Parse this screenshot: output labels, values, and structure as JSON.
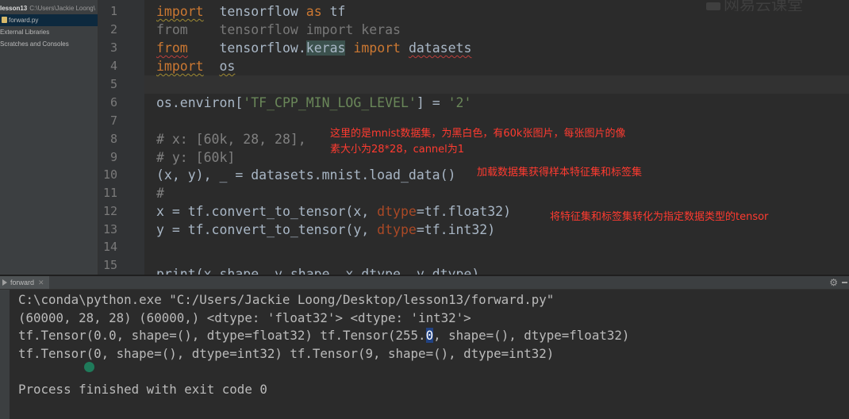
{
  "sidebar": {
    "project_name": "lesson13",
    "project_path": "C:\\Users\\Jackie Loong\\",
    "items": [
      {
        "label": "forward.py"
      },
      {
        "label": "External Libraries"
      },
      {
        "label": "Scratches and Consoles"
      }
    ]
  },
  "editor": {
    "line_numbers": [
      "1",
      "2",
      "3",
      "4",
      "5",
      "6",
      "7",
      "8",
      "9",
      "10",
      "11",
      "12",
      "13",
      "14",
      "15"
    ],
    "code": {
      "l1_kw": "import",
      "l1_mod": "tensorflow",
      "l1_as": "as",
      "l1_alias": "tf",
      "l2": "from    tensorflow import keras",
      "l3_from": "from",
      "l3_mod": "tensorflow.",
      "l3_keras": "keras",
      "l3_import": "import",
      "l3_name": "datasets",
      "l4_kw": "import",
      "l4_mod": "os",
      "l6_pre": "os.environ[",
      "l6_key": "'TF_CPP_MIN_LOG_LEVEL'",
      "l6_mid": "] = ",
      "l6_val": "'2'",
      "l8": "# x: [60k, 28, 28],",
      "l9": "# y: [60k]",
      "l10": "(x, y), _ = datasets.mnist.load_data()",
      "l11": "#",
      "l12_pre": "x = tf.convert_to_tensor(x, ",
      "l12_param": "dtype",
      "l12_post": "=tf.float32)",
      "l13_pre": "y = tf.convert_to_tensor(y, ",
      "l13_param": "dtype",
      "l13_post": "=tf.int32)",
      "l15": "print(x.shape, y.shape, x.dtype, y.dtype)"
    },
    "annotations": {
      "mnist_note_1": "这里的是mnist数据集，为黑白色，有60k张图片，每张图片的像",
      "mnist_note_2": "素大小为28*28，cannel为1",
      "load_note": "加载数据集获得样本特征集和标签集",
      "convert_note": "将特征集和标签集转化为指定数据类型的tensor"
    },
    "watermark": "网易云课堂"
  },
  "run_panel": {
    "tab_label": "forward",
    "console": {
      "line1": "C:\\conda\\python.exe \"C:/Users/Jackie Loong/Desktop/lesson13/forward.py\"",
      "line2": "(60000, 28, 28) (60000,) <dtype: 'float32'> <dtype: 'int32'>",
      "line3_pre": "tf.Tensor(0.0, shape=(), dtype=float32) tf.Tensor(255.",
      "line3_sel": "0",
      "line3_post": ", shape=(), dtype=float32)",
      "line4": "tf.Tensor(0, shape=(), dtype=int32) tf.Tensor(9, shape=(), dtype=int32)",
      "exit": "Process finished with exit code 0"
    }
  },
  "icons": [
    "file-icon",
    "fold-marker-icon",
    "run-icon",
    "close-icon",
    "gear-icon",
    "minimize-icon"
  ]
}
